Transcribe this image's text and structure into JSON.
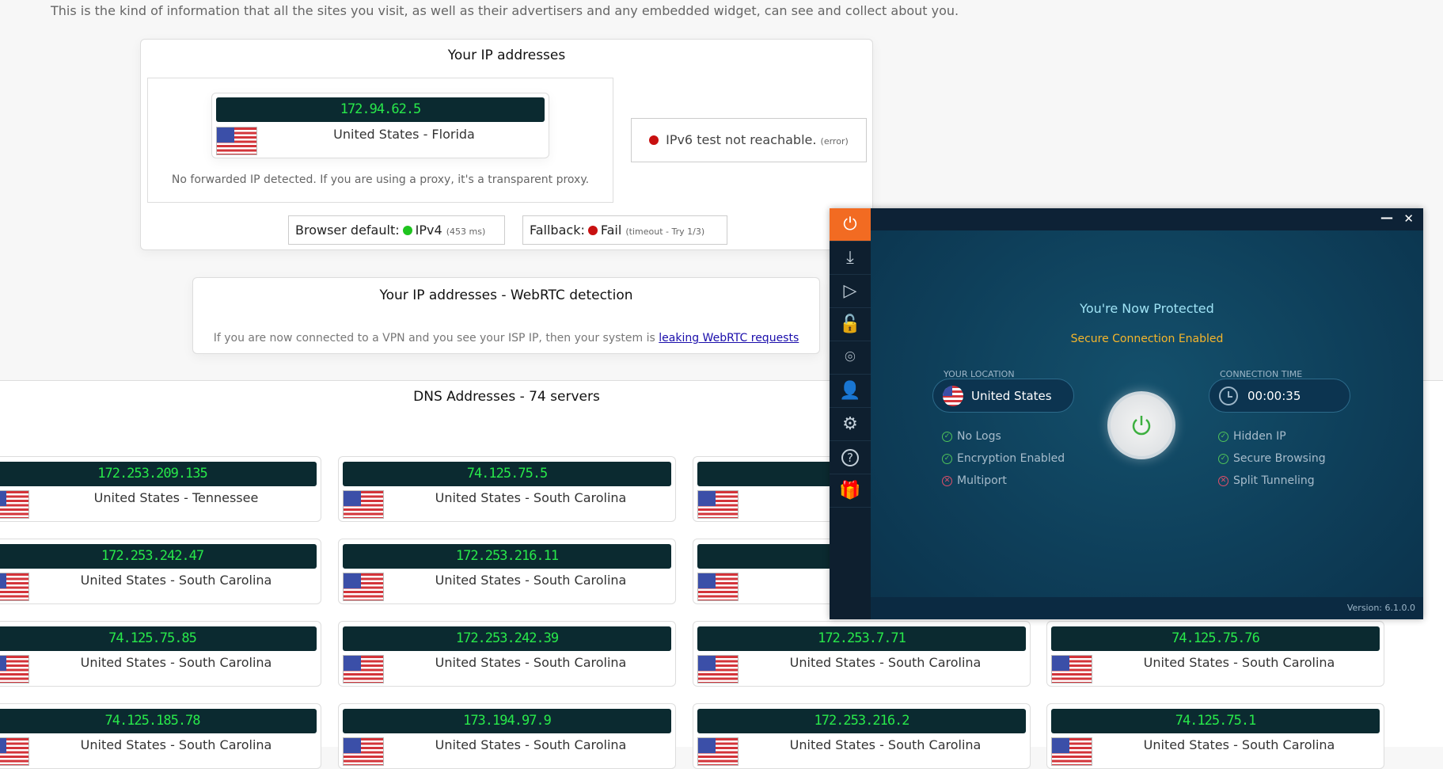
{
  "intro": "This is the kind of information that all the sites you visit, as well as their advertisers and any embedded widget, can see and collect about you.",
  "ip_panel": {
    "title": "Your IP addresses",
    "ip": "172.94.62.5",
    "location": "United States - Florida",
    "forwarded_note": "No forwarded IP detected. If you are using a proxy, it's a transparent proxy.",
    "ipv6_text": "IPv6 test not reachable.",
    "ipv6_note": "(error)",
    "browser_default_label": "Browser default:",
    "browser_default_value": "IPv4",
    "browser_default_note": "(453 ms)",
    "fallback_label": "Fallback:",
    "fallback_value": "Fail",
    "fallback_note": "(timeout - Try 1/3)",
    "colors": {
      "ok": "#1fc41f",
      "error": "#c81010"
    }
  },
  "webrtc": {
    "title": "Your IP addresses - WebRTC detection",
    "note": "If you are now connected to a VPN and you see your ISP IP, then your system is",
    "link": "leaking WebRTC requests"
  },
  "dns": {
    "title": "DNS Addresses - 74 servers",
    "cards": [
      {
        "ip": "172.253.209.135",
        "location": "United States - Tennessee"
      },
      {
        "ip": "74.125.75.5",
        "location": "United States - South Carolina"
      },
      {
        "ip": "17",
        "location": "United"
      },
      {
        "ip": "172.253.242.47",
        "location": "United States - South Carolina"
      },
      {
        "ip": "172.253.216.11",
        "location": "United States - South Carolina"
      },
      {
        "ip": "17",
        "location": "United"
      },
      {
        "ip": "74.125.75.85",
        "location": "United States - South Carolina"
      },
      {
        "ip": "172.253.242.39",
        "location": "United States - South Carolina"
      },
      {
        "ip": "172.253.7.71",
        "location": "United States - South Carolina"
      },
      {
        "ip": "74.125.75.76",
        "location": "United States - South Carolina"
      },
      {
        "ip": "74.125.185.78",
        "location": "United States - South Carolina"
      },
      {
        "ip": "173.194.97.9",
        "location": "United States - South Carolina"
      },
      {
        "ip": "172.253.216.2",
        "location": "United States - South Carolina"
      },
      {
        "ip": "74.125.75.1",
        "location": "United States - South Carolina"
      }
    ]
  },
  "vpn": {
    "sidebar": [
      "power-icon",
      "download-icon",
      "play-icon",
      "lock-icon",
      "ip-location-icon",
      "user-icon",
      "gear-icon",
      "help-icon",
      "gift-icon"
    ],
    "minimize": "—",
    "close": "✕",
    "status": "You're Now Protected",
    "substatus": "Secure Connection Enabled",
    "location_label": "YOUR LOCATION",
    "location": "United States",
    "time_label": "CONNECTION TIME",
    "time": "00:00:35",
    "left_features": [
      {
        "label": "No Logs",
        "on": true
      },
      {
        "label": "Encryption Enabled",
        "on": true
      },
      {
        "label": "Multiport",
        "on": false
      }
    ],
    "right_features": [
      {
        "label": "Hidden IP",
        "on": true
      },
      {
        "label": "Secure Browsing",
        "on": true
      },
      {
        "label": "Split Tunneling",
        "on": false
      }
    ],
    "version": "Version:  6.1.0.0",
    "colors": {
      "accent": "#f26b22",
      "status": "#9fe3f5",
      "substatus": "#f5b52b"
    }
  }
}
